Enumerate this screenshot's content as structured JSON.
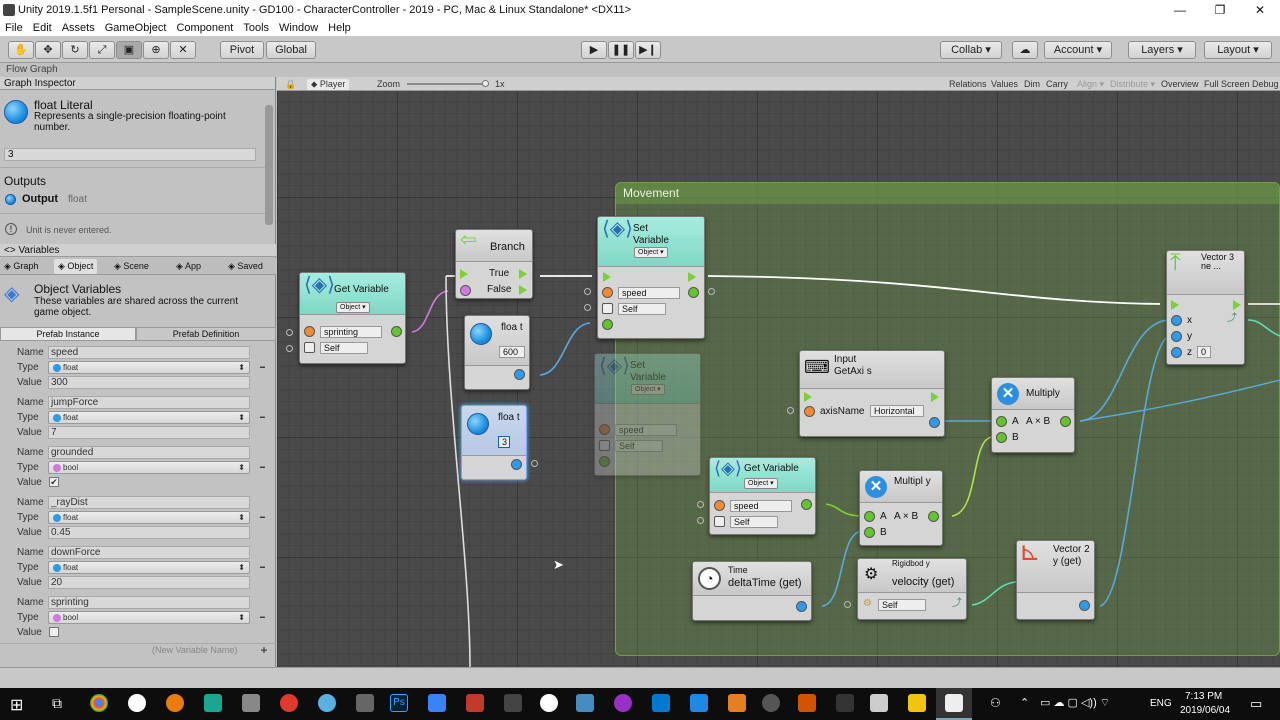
{
  "window": {
    "title": "Unity 2019.1.5f1 Personal - SampleScene.unity - GD100 - CharacterController - 2019 - PC, Mac & Linux Standalone* <DX11>"
  },
  "menu": [
    "File",
    "Edit",
    "Assets",
    "GameObject",
    "Component",
    "Tools",
    "Window",
    "Help"
  ],
  "toolbar": {
    "pivot": "Pivot",
    "global": "Global",
    "collab": "Collab",
    "account": "Account",
    "layers": "Layers",
    "layout": "Layout"
  },
  "tab": {
    "flow_graph": "Flow Graph"
  },
  "inspector": {
    "header": "Graph Inspector",
    "node_title": "float Literal",
    "node_desc": "Represents a single-precision floating-point number.",
    "value": "3",
    "outputs_label": "Outputs",
    "output_name": "Output",
    "output_type": "float",
    "warning": "Unit is never entered."
  },
  "variables": {
    "header": "<> Variables",
    "tabs": [
      "Graph",
      "Object",
      "Scene",
      "App",
      "Saved"
    ],
    "section_title": "Object Variables",
    "section_desc": "These variables are shared across the current game object.",
    "prefab_tabs": [
      "Prefab Instance",
      "Prefab Definition"
    ],
    "name_label": "Name",
    "type_label": "Type",
    "value_label": "Value",
    "items": [
      {
        "name": "speed",
        "type": "float",
        "value": "300",
        "color": "#2e9be9"
      },
      {
        "name": "jumpForce",
        "type": "float",
        "value": "7",
        "color": "#2e9be9"
      },
      {
        "name": "grounded",
        "type": "bool",
        "value": "✔",
        "color": "#d07ae0"
      },
      {
        "name": "_rayDist",
        "type": "float",
        "value": "0.45",
        "color": "#2e9be9"
      },
      {
        "name": "downForce",
        "type": "float",
        "value": "20",
        "color": "#2e9be9"
      },
      {
        "name": "sprinting",
        "type": "bool",
        "value": "",
        "color": "#d07ae0"
      }
    ],
    "new_placeholder": "(New Variable Name)"
  },
  "graphbar": {
    "player": "Player",
    "zoom": "Zoom",
    "zoom_value": "1x",
    "buttons": [
      "Relations",
      "Values",
      "Dim",
      "Carry",
      "Align ▾",
      "Distribute ▾",
      "Overview",
      "Full Screen",
      "Debug"
    ]
  },
  "group": {
    "title": "Movement"
  },
  "nodes": {
    "get_var1": {
      "title": "Get Variable",
      "scope": "Object ▾",
      "var": "sprinting",
      "target": "Self"
    },
    "branch": {
      "title": "Branch",
      "true": "True",
      "false": "False"
    },
    "float1": {
      "title": "floa t",
      "value": "600"
    },
    "float2": {
      "title": "floa t",
      "value": "3"
    },
    "set_var": {
      "title": "Set Variable",
      "scope": "Object ▾",
      "var": "speed",
      "target": "Self"
    },
    "set_var_ghost": {
      "title": "Set Variable",
      "scope": "Object ▾",
      "var": "speed",
      "target": "Self"
    },
    "input": {
      "title1": "Input",
      "title2": "GetAxi s",
      "param": "axisName",
      "param_value": "Horizontal"
    },
    "multiply1": {
      "title": "Multiply",
      "a": "A",
      "axb": "A × B",
      "b": "B"
    },
    "multiply2": {
      "title": "Multipl y",
      "a": "A",
      "axb": "A × B",
      "b": "B"
    },
    "get_var2": {
      "title": "Get Variable",
      "scope": "Object ▾",
      "var": "speed",
      "target": "Self"
    },
    "time": {
      "title1": "Time",
      "title2": "deltaTime (get)"
    },
    "rigidbody": {
      "title1": "Rigidbod y",
      "title2": "velocity (get)",
      "target": "Self"
    },
    "vector3": {
      "title": "Vector 3 ne ...",
      "x": "x",
      "y": "y",
      "z": "z",
      "z_value": "0"
    },
    "vector2": {
      "title": "Vector 2 y (get)"
    }
  },
  "taskbar": {
    "time": "7:13 PM",
    "date": "2019/06/04",
    "lang": "ENG"
  }
}
